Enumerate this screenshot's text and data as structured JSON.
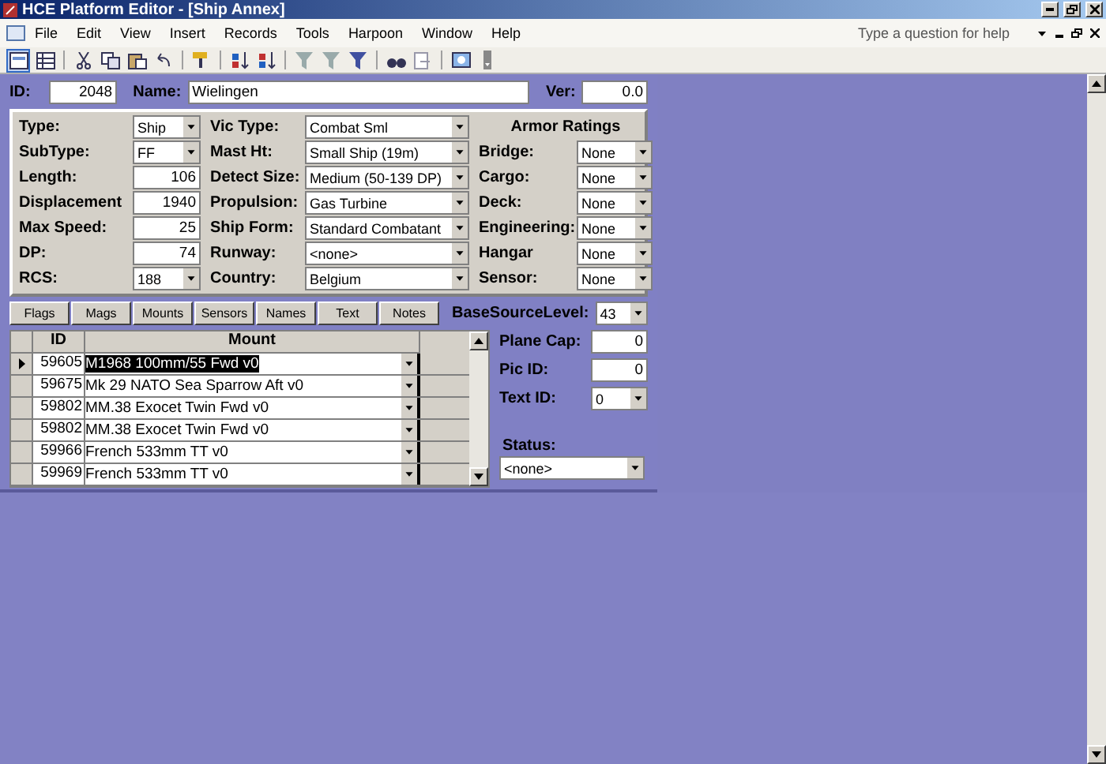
{
  "window": {
    "title": "HCE Platform Editor - [Ship Annex]"
  },
  "menu": [
    "File",
    "Edit",
    "View",
    "Insert",
    "Records",
    "Tools",
    "Harpoon",
    "Window",
    "Help"
  ],
  "help_box": {
    "placeholder": "Type a question for help"
  },
  "header": {
    "id_label": "ID:",
    "id": "2048",
    "name_label": "Name:",
    "name": "Wielingen",
    "ver_label": "Ver:",
    "ver": "0.0"
  },
  "column_1": [
    {
      "label": "Type:",
      "kind": "combo",
      "value": "Ship"
    },
    {
      "label": "SubType:",
      "kind": "combo",
      "value": "FF"
    },
    {
      "label": "Length:",
      "kind": "text",
      "value": "106"
    },
    {
      "label": "Displacement",
      "kind": "text",
      "value": "1940"
    },
    {
      "label": "Max Speed:",
      "kind": "text",
      "value": "25"
    },
    {
      "label": "DP:",
      "kind": "text",
      "value": "74"
    },
    {
      "label": "RCS:",
      "kind": "combo",
      "value": "188"
    }
  ],
  "column_2": [
    {
      "label": "Vic Type:",
      "value": "Combat Sml"
    },
    {
      "label": "Mast Ht:",
      "value": "Small Ship (19m)"
    },
    {
      "label": "Detect Size:",
      "value": "Medium (50-139 DP)"
    },
    {
      "label": "Propulsion:",
      "value": "Gas Turbine"
    },
    {
      "label": "Ship Form:",
      "value": "Standard Combatant"
    },
    {
      "label": "Runway:",
      "value": "<none>"
    },
    {
      "label": "Country:",
      "value": "Belgium"
    }
  ],
  "armor": {
    "title": "Armor Ratings",
    "items": [
      {
        "label": "Bridge:",
        "value": "None"
      },
      {
        "label": "Cargo:",
        "value": "None"
      },
      {
        "label": "Deck:",
        "value": "None"
      },
      {
        "label": "Engineering:",
        "value": "None"
      },
      {
        "label": "Hangar",
        "value": "None"
      },
      {
        "label": "Sensor:",
        "value": "None"
      }
    ]
  },
  "tabs": [
    "Flags",
    "Mags",
    "Mounts",
    "Sensors",
    "Names",
    "Text",
    "Notes"
  ],
  "mounts": {
    "columns": [
      "ID",
      "Mount"
    ],
    "rows": [
      {
        "id": "59605",
        "mount": "M1968 100mm/55 Fwd v0",
        "selected": true
      },
      {
        "id": "59675",
        "mount": "Mk 29 NATO Sea Sparrow Aft v0",
        "selected": false
      },
      {
        "id": "59802",
        "mount": "MM.38 Exocet Twin Fwd v0",
        "selected": false
      },
      {
        "id": "59802",
        "mount": "MM.38 Exocet Twin Fwd v0",
        "selected": false
      },
      {
        "id": "59966",
        "mount": "French 533mm TT v0",
        "selected": false
      },
      {
        "id": "59969",
        "mount": "French 533mm TT v0",
        "selected": false
      }
    ]
  },
  "side_fields": [
    {
      "label": "BaseSourceLevel:",
      "kind": "combo",
      "value": "43"
    },
    {
      "label": "Plane Cap:",
      "kind": "text",
      "value": "0"
    },
    {
      "label": "Pic ID:",
      "kind": "text",
      "value": "0"
    },
    {
      "label": "Text ID:",
      "kind": "combo",
      "value": "0"
    }
  ],
  "status": {
    "label": "Status:",
    "value": "<none>"
  }
}
